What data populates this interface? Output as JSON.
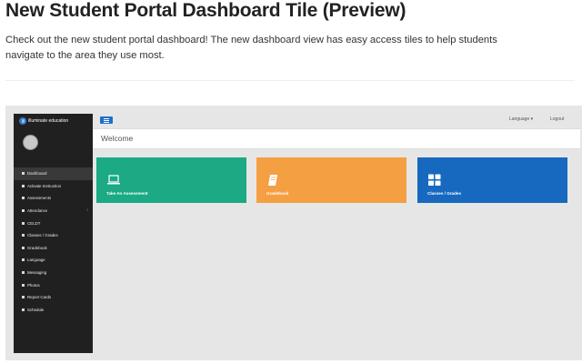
{
  "page": {
    "title": "New Student Portal Dashboard Tile (Preview)",
    "intro": "Check out the new student portal dashboard! The new dashboard view has easy access tiles to help students navigate to the area they use most."
  },
  "portal": {
    "brand": "illuminate education",
    "topbar": {
      "language": "Language ▾",
      "logout": "Logout"
    },
    "welcome": "Welcome",
    "nav": [
      {
        "label": "Dashboard",
        "icon": "home-icon",
        "active": true
      },
      {
        "label": "Activate Instruction",
        "icon": "bookmark-icon"
      },
      {
        "label": "Assessments",
        "icon": "laptop-icon"
      },
      {
        "label": "Attendance",
        "icon": "check-icon",
        "has_submenu": true
      },
      {
        "label": "CELDT",
        "icon": "book-icon"
      },
      {
        "label": "Classes / Grades",
        "icon": "grid-icon"
      },
      {
        "label": "Gradebook",
        "icon": "gradebook-icon"
      },
      {
        "label": "Language",
        "icon": "globe-icon"
      },
      {
        "label": "Messaging",
        "icon": "chat-icon"
      },
      {
        "label": "Photos",
        "icon": "photo-icon"
      },
      {
        "label": "Report Cards",
        "icon": "report-icon"
      },
      {
        "label": "Schedule",
        "icon": "calendar-icon"
      }
    ],
    "tiles": [
      {
        "label": "Take An Assessment",
        "icon": "laptop-icon",
        "color": "#1baa83"
      },
      {
        "label": "Gradebook",
        "icon": "book-icon",
        "color": "#f59f43"
      },
      {
        "label": "Classes / Grades",
        "icon": "grid-icon",
        "color": "#1669bf"
      }
    ]
  }
}
